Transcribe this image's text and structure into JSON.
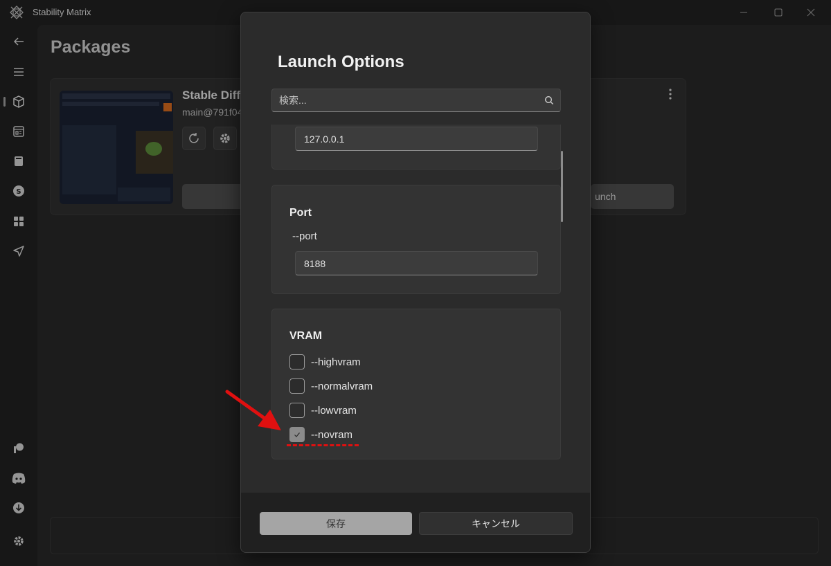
{
  "app": {
    "title": "Stability Matrix"
  },
  "page": {
    "title": "Packages"
  },
  "package": {
    "name": "Stable Diff",
    "branch": "main@791f04",
    "launch_label": "unch"
  },
  "dialog": {
    "title": "Launch Options",
    "search": {
      "placeholder": "検索...",
      "value": ""
    },
    "options": {
      "host": {
        "value": "127.0.0.1"
      },
      "port": {
        "title": "Port",
        "flag": "--port",
        "value": "8188"
      },
      "vram": {
        "title": "VRAM",
        "choices": [
          {
            "label": "--highvram",
            "checked": false
          },
          {
            "label": "--normalvram",
            "checked": false
          },
          {
            "label": "--lowvram",
            "checked": false
          },
          {
            "label": "--novram",
            "checked": true
          }
        ]
      }
    },
    "save_label": "保存",
    "cancel_label": "キャンセル"
  },
  "colors": {
    "annotation": "#e01010",
    "accent": "#a5a5a5"
  },
  "icons": {
    "sidebar": [
      "back-icon",
      "menu-icon",
      "package-icon",
      "browser-icon",
      "notebook-icon",
      "civitai-icon",
      "apps-icon",
      "send-icon",
      "patreon-icon",
      "discord-icon",
      "download-icon",
      "settings-icon"
    ]
  }
}
